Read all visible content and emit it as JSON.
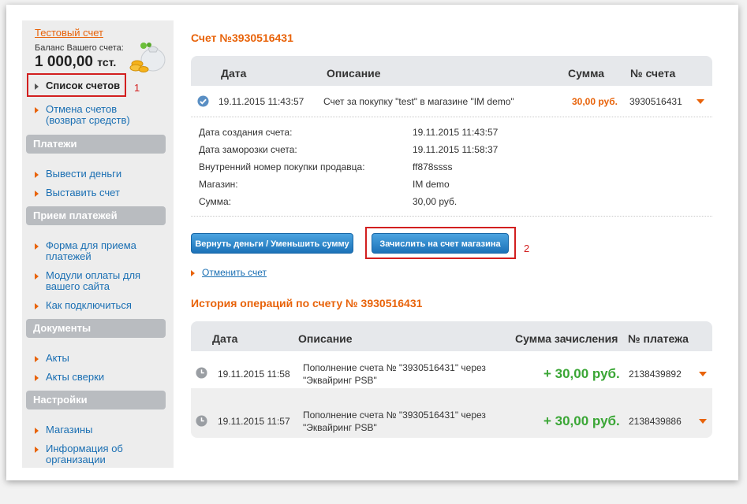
{
  "sidebar": {
    "account_link": "Тестовый счет",
    "balance_label": "Баланс Вашего счета:",
    "balance_value": "1 000,00",
    "balance_currency": "тст.",
    "items_top": [
      {
        "label": "Список счетов"
      },
      {
        "label1": "Отмена счетов",
        "label2": "(возврат средств)"
      }
    ],
    "sections": [
      {
        "title": "Платежи",
        "items": [
          "Вывести деньги",
          "Выставить счет"
        ]
      },
      {
        "title": "Прием платежей",
        "items": [
          [
            "Форма для приема",
            "платежей"
          ],
          [
            "Модули оплаты для",
            "вашего сайта"
          ],
          [
            "Как подключиться"
          ]
        ]
      },
      {
        "title": "Документы",
        "items": [
          "Акты",
          "Акты сверки"
        ]
      },
      {
        "title": "Настройки",
        "items": [
          [
            "Магазины"
          ],
          [
            "Информация об",
            "организации"
          ]
        ]
      }
    ]
  },
  "annotations": {
    "one": "1",
    "two": "2"
  },
  "invoice": {
    "title": "Счет №3930516431",
    "headers": {
      "date": "Дата",
      "description": "Описание",
      "amount": "Сумма",
      "number": "№ счета"
    },
    "row": {
      "date": "19.11.2015 11:43:57",
      "description": "Счет за покупку \"test\" в магазине \"IM demo\"",
      "amount": "30,00 руб.",
      "number": "3930516431"
    },
    "details": [
      {
        "label": "Дата создания счета:",
        "value": "19.11.2015 11:43:57"
      },
      {
        "label": "Дата заморозки счета:",
        "value": "19.11.2015 11:58:37"
      },
      {
        "label": "Внутренний номер покупки продавца:",
        "value": "ff878ssss"
      },
      {
        "label": "Магазин:",
        "value": "IM demo"
      },
      {
        "label": "Сумма:",
        "value": "30,00 руб."
      }
    ],
    "btn_refund": "Вернуть деньги / Уменьшить сумму",
    "btn_credit": "Зачислить на счет магазина",
    "cancel_link": "Отменить счет"
  },
  "history": {
    "title": "История операций по счету № 3930516431",
    "headers": {
      "date": "Дата",
      "description": "Описание",
      "amount": "Сумма зачисления",
      "number": "№ платежа"
    },
    "rows": [
      {
        "date": "19.11.2015 11:58",
        "desc1": "Пополнение счета № \"3930516431\" через",
        "desc2": "\"Эквайринг PSB\"",
        "amount": "+ 30,00 руб.",
        "number": "2138439892"
      },
      {
        "date": "19.11.2015 11:57",
        "desc1": "Пополнение счета № \"3930516431\" через",
        "desc2": "\"Эквайринг PSB\"",
        "amount": "+ 30,00 руб.",
        "number": "2138439886"
      }
    ]
  },
  "colors": {
    "accent": "#e8630a",
    "link": "#1a6fb3",
    "positive": "#3aa635",
    "annotation": "#d21f1f"
  }
}
